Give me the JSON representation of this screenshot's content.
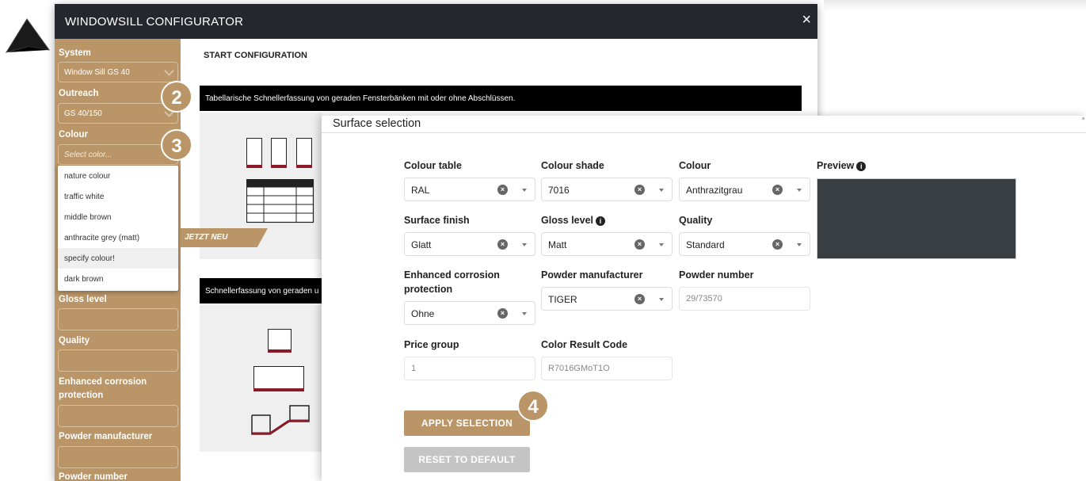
{
  "configurator": {
    "title": "WINDOWSILL CONFIGURATOR",
    "close_glyph": "×",
    "main_title": "START CONFIGURATION",
    "banner1": "Tabellarische Schnellerfassung von geraden Fensterbänken mit oder ohne Abschlüssen.",
    "banner2": "Schnellerfassung von geraden u",
    "new_tag": "JETZT NEU"
  },
  "sidebar": {
    "system_label": "System",
    "system_value": "Window Sill GS 40",
    "outreach_label": "Outreach",
    "outreach_value": "GS 40/150",
    "colour_label": "Colour",
    "colour_placeholder": "Select color...",
    "colour_options": [
      "nature colour",
      "traffic white",
      "middle brown",
      "anthracite grey (matt)",
      "specify colour!",
      "dark brown"
    ],
    "gloss_label": "Gloss level",
    "quality_label": "Quality",
    "corrosion_label_1": "Enhanced corrosion",
    "corrosion_label_2": "protection",
    "powder_manufacturer_label": "Powder manufacturer",
    "powder_number_label": "Powder number"
  },
  "badges": [
    "2",
    "3",
    "4"
  ],
  "surface": {
    "title": "Surface selection",
    "colour_table": {
      "label": "Colour table",
      "value": "RAL"
    },
    "colour_shade": {
      "label": "Colour shade",
      "value": "7016"
    },
    "colour": {
      "label": "Colour",
      "value": "Anthrazitgrau"
    },
    "preview_label": "Preview",
    "surface_finish": {
      "label": "Surface finish",
      "value": "Glatt"
    },
    "gloss_level": {
      "label": "Gloss level",
      "value": "Matt"
    },
    "quality": {
      "label": "Quality",
      "value": "Standard"
    },
    "corrosion": {
      "label_1": "Enhanced corrosion",
      "label_2": "protection",
      "value": "Ohne"
    },
    "powder_manufacturer": {
      "label": "Powder manufacturer",
      "value": "TIGER"
    },
    "powder_number": {
      "label": "Powder number",
      "value": "29/73570"
    },
    "price_group": {
      "label": "Price group",
      "value": "1"
    },
    "color_result_code": {
      "label": "Color Result Code",
      "value": "R7016GMoT1O"
    },
    "apply_label": "APPLY SELECTION",
    "reset_label": "RESET TO DEFAULT",
    "info_glyph": "i",
    "clear_glyph": "×"
  },
  "colors": {
    "accent": "#b99567",
    "header": "#24272d",
    "preview_swatch": "#383e42",
    "profile_red": "#8b1a28"
  },
  "icons": {
    "cursor": "mouse-cursor-icon",
    "close": "close-icon",
    "chevron": "chevron-down-icon",
    "info": "info-icon",
    "clear": "clear-icon",
    "caret": "caret-down-icon"
  }
}
